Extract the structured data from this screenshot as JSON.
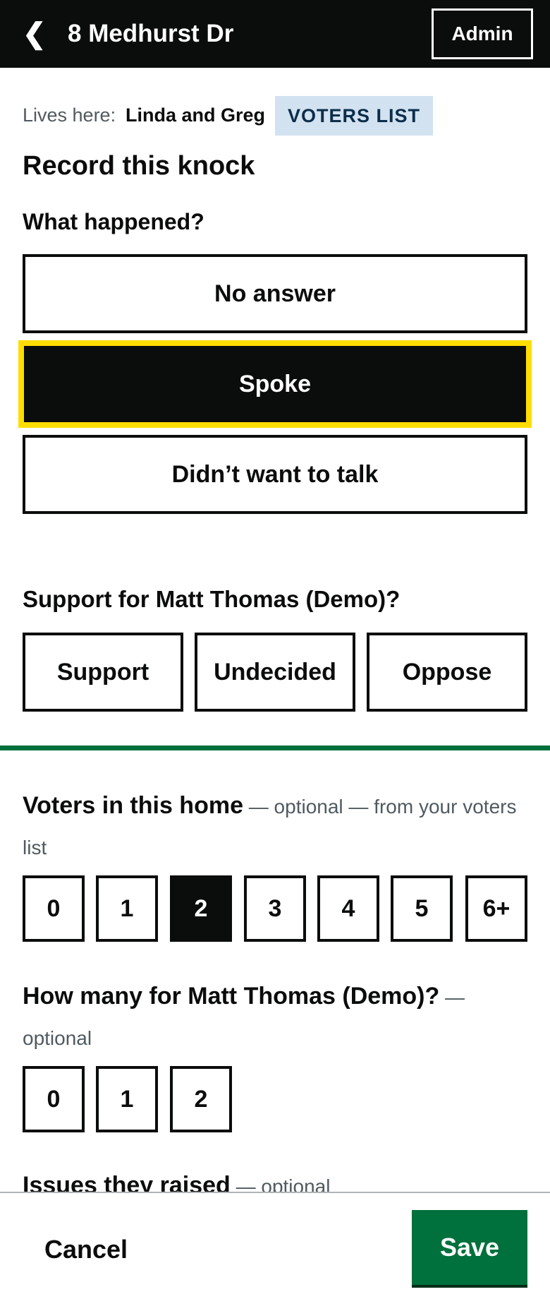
{
  "header": {
    "back_icon": "❮",
    "title": "8 Medhurst Dr",
    "admin_label": "Admin"
  },
  "household": {
    "lives_here_label": "Lives here:",
    "names": "Linda and Greg",
    "source_tag": "VOTERS LIST"
  },
  "record": {
    "title": "Record this knock",
    "question": "What happened?",
    "outcomes": [
      "No answer",
      "Spoke",
      "Didn’t want to talk"
    ],
    "selected_outcome": "Spoke"
  },
  "support": {
    "question": "Support for Matt Thomas (Demo)?",
    "options": [
      "Support",
      "Undecided",
      "Oppose"
    ]
  },
  "voters_in_home": {
    "label": "Voters in this home",
    "suffix": " — optional — from your voters list",
    "options": [
      "0",
      "1",
      "2",
      "3",
      "4",
      "5",
      "6+"
    ],
    "selected": "2"
  },
  "how_many": {
    "label": "How many for Matt Thomas (Demo)?",
    "suffix": " — optional",
    "options": [
      "0",
      "1",
      "2"
    ]
  },
  "issues": {
    "label": "Issues they raised",
    "suffix": " — optional"
  },
  "footer": {
    "cancel_label": "Cancel",
    "save_label": "Save"
  },
  "colors": {
    "header_bg": "#0b0c0c",
    "focus_yellow": "#ffdd00",
    "brand_green": "#00703c",
    "tag_bg": "#d2e2f1"
  }
}
